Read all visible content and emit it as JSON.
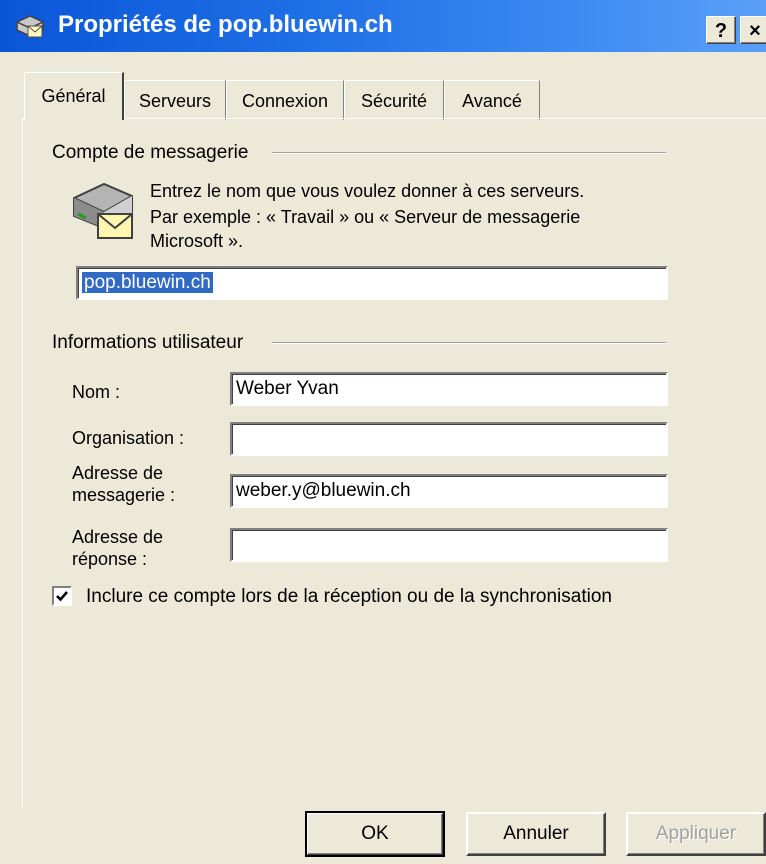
{
  "window": {
    "title": "Propriétés de pop.bluewin.ch",
    "help_label": "?",
    "close_label": "×"
  },
  "tabs": [
    {
      "label": "Général",
      "active": true
    },
    {
      "label": "Serveurs",
      "active": false
    },
    {
      "label": "Connexion",
      "active": false
    },
    {
      "label": "Sécurité",
      "active": false
    },
    {
      "label": "Avancé",
      "active": false
    }
  ],
  "mail_account": {
    "group_label": "Compte de messagerie",
    "description_line1": "Entrez le nom que vous voulez donner à ces serveurs.",
    "description_line2": "Par exemple : « Travail » ou « Serveur de messagerie",
    "description_line3": "Microsoft ».",
    "account_name_value": "pop.bluewin.ch"
  },
  "user_info": {
    "group_label": "Informations utilisateur",
    "name_label": "Nom :",
    "name_value": "Weber Yvan",
    "organization_label": "Organisation :",
    "organization_value": "",
    "email_label_line1": "Adresse de",
    "email_label_line2": "messagerie :",
    "email_value": "weber.y@bluewin.ch",
    "reply_label_line1": "Adresse de",
    "reply_label_line2": "réponse :",
    "reply_value": ""
  },
  "include_checkbox": {
    "label": "Inclure ce compte lors de la réception ou de la synchronisation",
    "checked": true
  },
  "buttons": {
    "ok_label": "OK",
    "cancel_label": "Annuler",
    "apply_label": "Appliquer"
  },
  "colors": {
    "titlebar": "#0a56d8",
    "dialog_background": "#ece9d8",
    "selection": "#316ac5"
  }
}
